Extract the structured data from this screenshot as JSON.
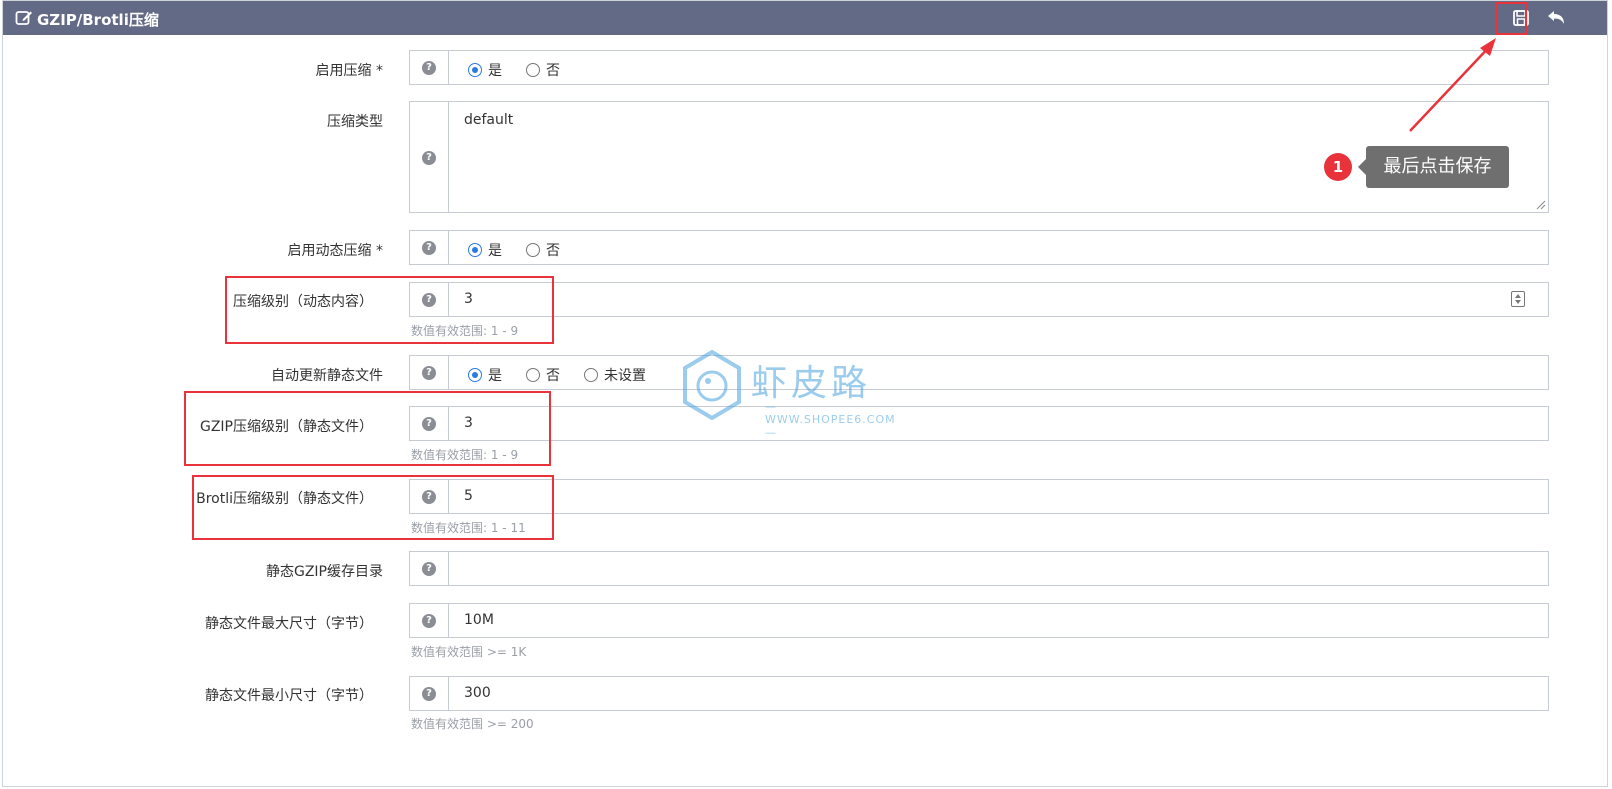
{
  "header": {
    "title": "GZIP/Brotli压缩",
    "edit_icon": "edit-icon",
    "save_icon": "save-icon",
    "undo_icon": "undo-icon"
  },
  "rows": {
    "enable_compression": {
      "label": "启用压缩 *",
      "options": [
        "是",
        "否"
      ],
      "selected": "是"
    },
    "compression_type": {
      "label": "压缩类型",
      "value": "default"
    },
    "enable_dynamic": {
      "label": "启用动态压缩 *",
      "options": [
        "是",
        "否"
      ],
      "selected": "是"
    },
    "dynamic_level": {
      "label": "压缩级别（动态内容）",
      "value": "3",
      "hint": "数值有效范围: 1 - 9"
    },
    "auto_update_static": {
      "label": "自动更新静态文件",
      "options": [
        "是",
        "否",
        "未设置"
      ],
      "selected": "是"
    },
    "gzip_static_level": {
      "label": "GZIP压缩级别（静态文件）",
      "value": "3",
      "hint": "数值有效范围: 1 - 9"
    },
    "brotli_static_level": {
      "label": "Brotli压缩级别（静态文件）",
      "value": "5",
      "hint": "数值有效范围: 1 - 11"
    },
    "static_gzip_cache_dir": {
      "label": "静态GZIP缓存目录",
      "value": ""
    },
    "static_max_size": {
      "label": "静态文件最大尺寸（字节）",
      "value": "10M",
      "hint": "数值有效范围 >= 1K"
    },
    "static_min_size": {
      "label": "静态文件最小尺寸（字节）",
      "value": "300",
      "hint": "数值有效范围 >= 200"
    }
  },
  "annotation": {
    "step": "1",
    "tooltip": "最后点击保存"
  },
  "watermark": {
    "text": "虾皮路",
    "sub": "— WWW.SHOPEE6.COM —"
  },
  "colors": {
    "header_bg": "#636a85",
    "highlight": "#e8333b",
    "radio_checked": "#2a7ae2"
  }
}
